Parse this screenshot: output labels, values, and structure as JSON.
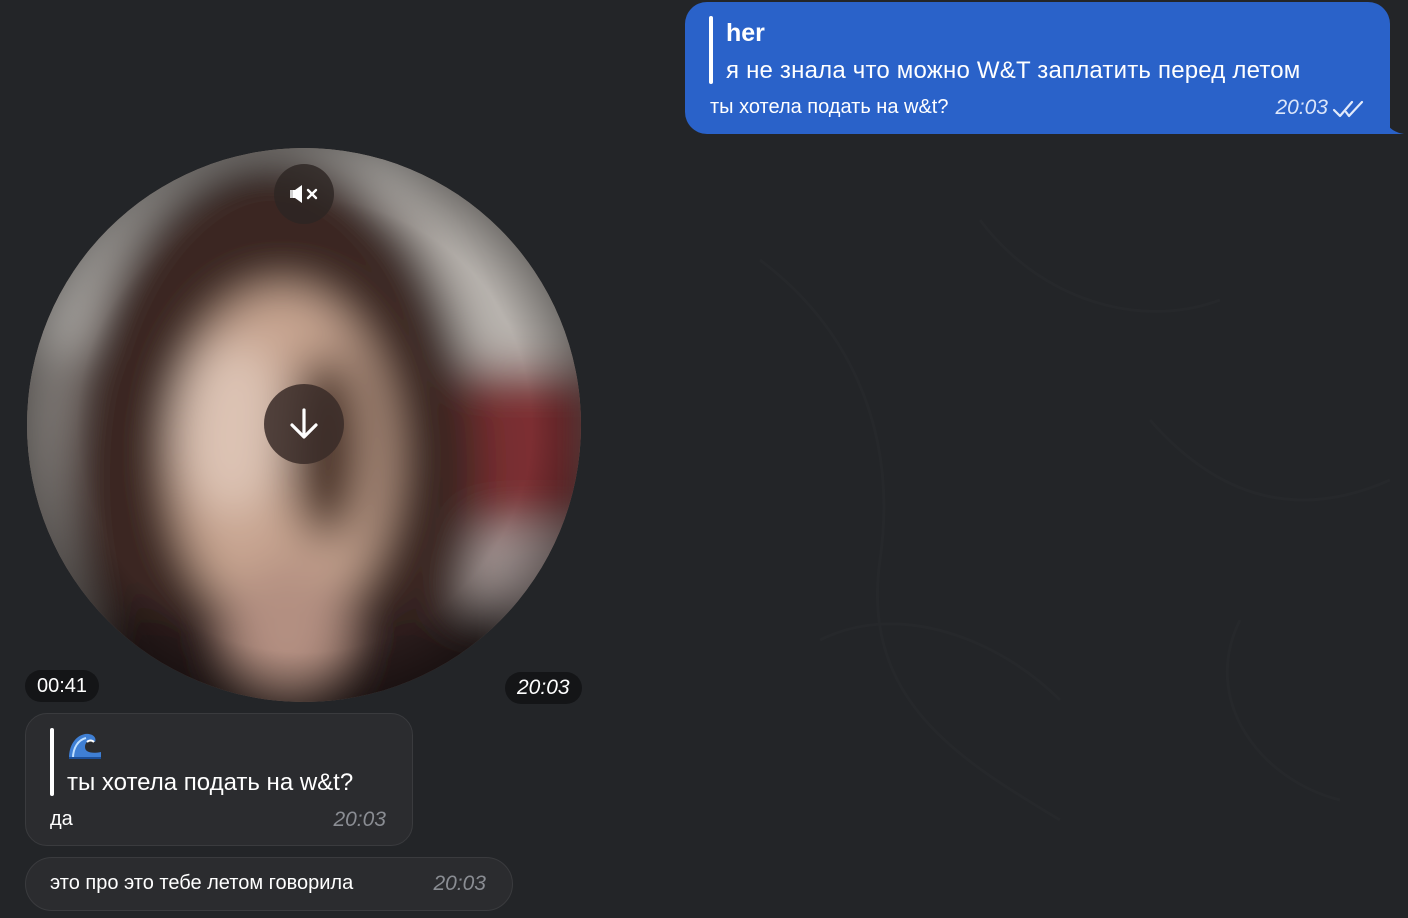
{
  "colors": {
    "background": "#232528",
    "outgoing_bubble": "#2a62c9",
    "incoming_bubble": "#2b2c2f",
    "time_muted": "#8a8d93"
  },
  "outgoing_message": {
    "quote_author": "her",
    "quote_text": "я не знала что можно W&T заплатить перед летом",
    "text": "ты хотела подать на w&t?",
    "time": "20:03",
    "status_icon": "double-check-icon"
  },
  "video_message": {
    "duration": "00:41",
    "time": "20:03",
    "mute_icon": "speaker-muted-icon",
    "download_icon": "arrow-down-icon"
  },
  "incoming_reply": {
    "quote_emoji_icon": "wave-emoji-icon",
    "quote_text": "ты хотела подать на w&t?",
    "text": "да",
    "time": "20:03"
  },
  "incoming_message": {
    "text": "это про это тебе летом говорила",
    "time": "20:03"
  }
}
